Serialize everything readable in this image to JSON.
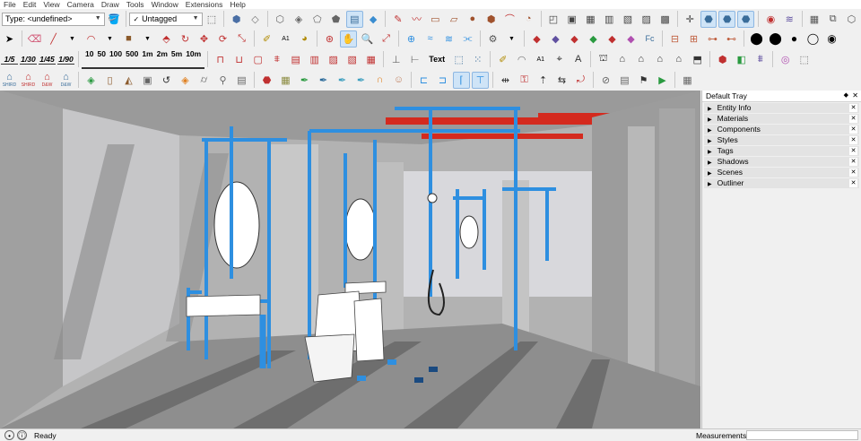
{
  "menu": [
    "File",
    "Edit",
    "View",
    "Camera",
    "Draw",
    "Tools",
    "Window",
    "Extensions",
    "Help"
  ],
  "entity_type": "Type: <undefined>",
  "tag_selector": "Untagged",
  "scale_buttons": [
    "1/5",
    "1/30",
    "1/45",
    "1/90"
  ],
  "ruler_labels": [
    "10",
    "50",
    "100",
    "500",
    "1m",
    "2m",
    "5m",
    "10m"
  ],
  "text_tool_label": "Text",
  "row4_labels": [
    "SHIRD",
    "SHIRD",
    "D&W",
    "D&W"
  ],
  "tray": {
    "title": "Default Tray",
    "panels": [
      "Entity Info",
      "Materials",
      "Components",
      "Styles",
      "Tags",
      "Shadows",
      "Scenes",
      "Outliner"
    ]
  },
  "status": {
    "text": "Ready",
    "measurements_label": "Measurements",
    "measurements_value": ""
  },
  "colors": {
    "pipe_blue": "#2e8fe0",
    "steel_red": "#d42a1e",
    "concrete": "#b4b4b4",
    "selection_blue": "#cfe4f7"
  }
}
